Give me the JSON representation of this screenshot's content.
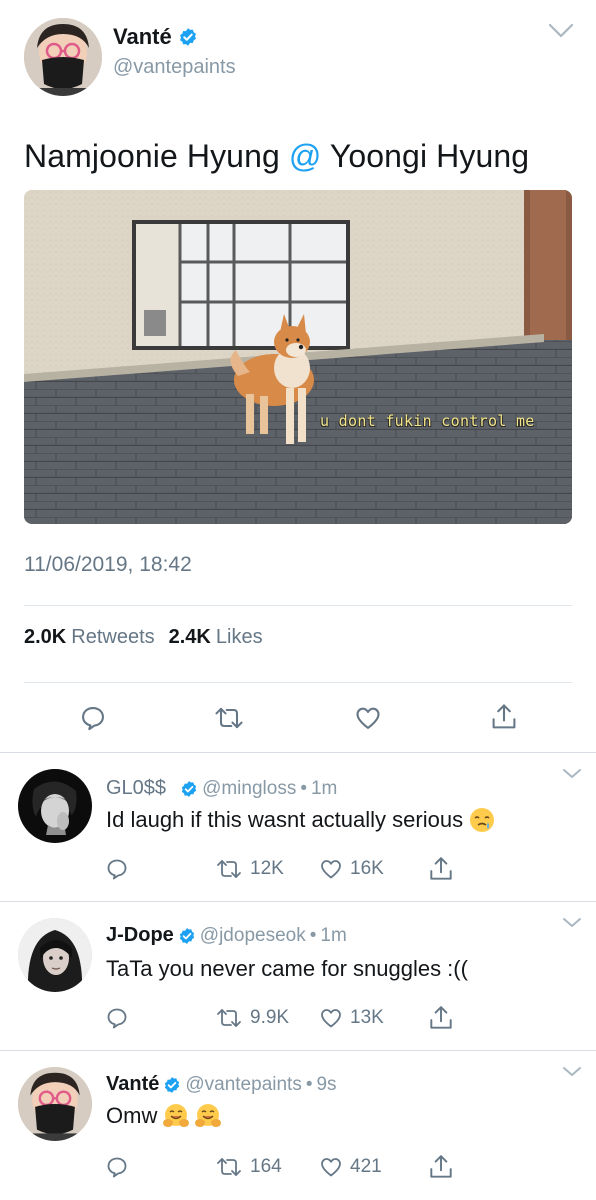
{
  "main_tweet": {
    "name": "Vanté",
    "handle": "@vantepaints",
    "text_before": "Namjoonie Hyung ",
    "text_mention": "@",
    "text_after": " Yoongi Hyung",
    "image_caption": "u dont fukin control me",
    "timestamp": "11/06/2019, 18:42",
    "retweets_count": "2.0K",
    "retweets_label": "Retweets",
    "likes_count": "2.4K",
    "likes_label": "Likes",
    "actions": [
      "reply-icon",
      "retweet-icon",
      "like-icon",
      "share-icon"
    ]
  },
  "replies": [
    {
      "name": "GL0$$",
      "handle": "@mingloss",
      "time": "1m",
      "text": "Id laugh if this wasnt actually serious",
      "emoji": "sleepy-face-emoji",
      "retweets": "12K",
      "likes": "16K"
    },
    {
      "name": "J-Dope",
      "handle": "@jdopeseok",
      "time": "1m",
      "text": "TaTa you never came for snuggles :((",
      "retweets": "9.9K",
      "likes": "13K"
    },
    {
      "name": "Vanté",
      "handle": "@vantepaints",
      "time": "9s",
      "text": "Omw",
      "emoji": "hugging-face-emoji",
      "retweets": "164",
      "likes": "421"
    }
  ],
  "separator": "•",
  "colors": {
    "accent": "#1da1f2",
    "text": "#14171a",
    "secondary": "#657786",
    "divider": "#e1e8ed"
  }
}
